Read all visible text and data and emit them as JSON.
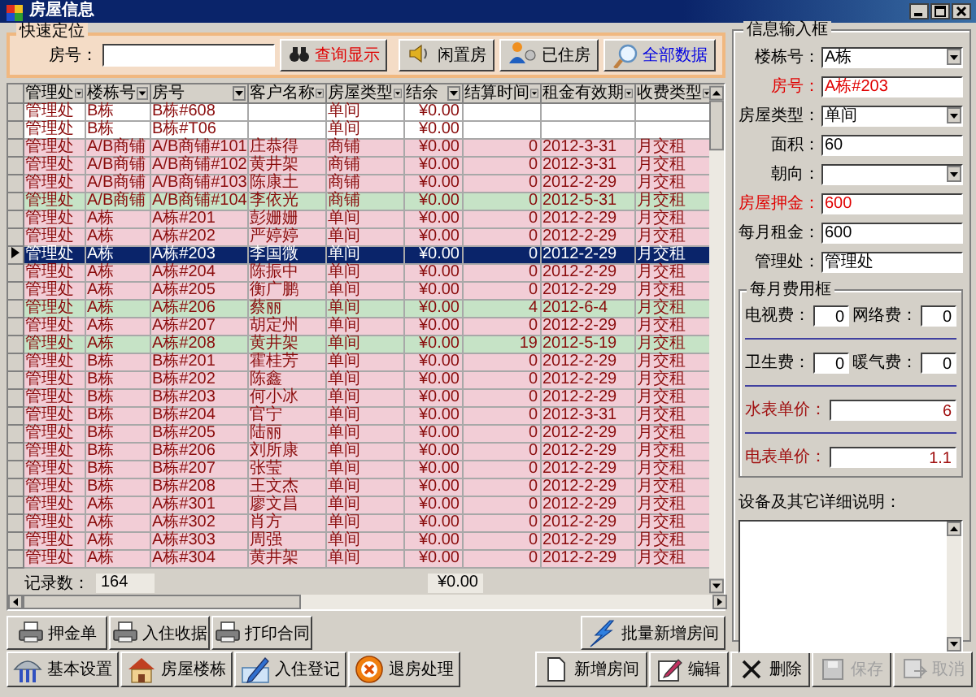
{
  "window": {
    "title": "房屋信息"
  },
  "quick_find": {
    "title": "快速定位",
    "label": "房号：",
    "search_button": "查询显示"
  },
  "filter_buttons": [
    {
      "label": "闲置房",
      "kind": "vacant"
    },
    {
      "label": "已住房",
      "kind": "occupied"
    },
    {
      "label": "全部数据",
      "kind": "all"
    }
  ],
  "table": {
    "columns": [
      "管理处",
      "楼栋号",
      "房号",
      "客户名称",
      "房屋类型",
      "结余",
      "结算时间",
      "租金有效期",
      "收费类型"
    ],
    "rows": [
      {
        "cells": [
          "管理处",
          "B栋",
          "B栋#608",
          null,
          "单间",
          "¥0.00",
          null,
          null,
          null
        ],
        "color": "#ffffff",
        "selected": false
      },
      {
        "cells": [
          "管理处",
          "B栋",
          "B栋#T06",
          null,
          "单间",
          "¥0.00",
          null,
          null,
          null
        ],
        "color": "#ffffff",
        "selected": false
      },
      {
        "cells": [
          "管理处",
          "A/B商铺",
          "A/B商铺#101",
          "庄恭得",
          "商铺",
          "¥0.00",
          "0",
          "2012-3-31",
          "月交租"
        ],
        "color": "#f2cdd6",
        "selected": false
      },
      {
        "cells": [
          "管理处",
          "A/B商铺",
          "A/B商铺#102",
          "黄井架",
          "商铺",
          "¥0.00",
          "0",
          "2012-3-31",
          "月交租"
        ],
        "color": "#f2cdd6",
        "selected": false
      },
      {
        "cells": [
          "管理处",
          "A/B商铺",
          "A/B商铺#103",
          "陈康土",
          "商铺",
          "¥0.00",
          "0",
          "2012-2-29",
          "月交租"
        ],
        "color": "#f2cdd6",
        "selected": false
      },
      {
        "cells": [
          "管理处",
          "A/B商铺",
          "A/B商铺#104",
          "李依光",
          "商铺",
          "¥0.00",
          "0",
          "2012-5-31",
          "月交租"
        ],
        "color": "#c6e3c6",
        "selected": false
      },
      {
        "cells": [
          "管理处",
          "A栋",
          "A栋#201",
          "彭姗姗",
          "单间",
          "¥0.00",
          "0",
          "2012-2-29",
          "月交租"
        ],
        "color": "#f2cdd6",
        "selected": false
      },
      {
        "cells": [
          "管理处",
          "A栋",
          "A栋#202",
          "严婷婷",
          "单间",
          "¥0.00",
          "0",
          "2012-2-29",
          "月交租"
        ],
        "color": "#f2cdd6",
        "selected": false
      },
      {
        "cells": [
          "管理处",
          "A栋",
          "A栋#203",
          "李国微",
          "单间",
          "¥0.00",
          "0",
          "2012-2-29",
          "月交租"
        ],
        "selected": true
      },
      {
        "cells": [
          "管理处",
          "A栋",
          "A栋#204",
          "陈振中",
          "单间",
          "¥0.00",
          "0",
          "2012-2-29",
          "月交租"
        ],
        "color": "#f2cdd6",
        "selected": false
      },
      {
        "cells": [
          "管理处",
          "A栋",
          "A栋#205",
          "衡广鹏",
          "单间",
          "¥0.00",
          "0",
          "2012-2-29",
          "月交租"
        ],
        "color": "#f2cdd6",
        "selected": false
      },
      {
        "cells": [
          "管理处",
          "A栋",
          "A栋#206",
          "蔡丽",
          "单间",
          "¥0.00",
          "4",
          "2012-6-4",
          "月交租"
        ],
        "color": "#c6e3c6",
        "selected": false
      },
      {
        "cells": [
          "管理处",
          "A栋",
          "A栋#207",
          "胡定州",
          "单间",
          "¥0.00",
          "0",
          "2012-2-29",
          "月交租"
        ],
        "color": "#f2cdd6",
        "selected": false
      },
      {
        "cells": [
          "管理处",
          "A栋",
          "A栋#208",
          "黄井架",
          "单间",
          "¥0.00",
          "19",
          "2012-5-19",
          "月交租"
        ],
        "color": "#c6e3c6",
        "selected": false
      },
      {
        "cells": [
          "管理处",
          "B栋",
          "B栋#201",
          "霍桂芳",
          "单间",
          "¥0.00",
          "0",
          "2012-2-29",
          "月交租"
        ],
        "color": "#f2cdd6",
        "selected": false
      },
      {
        "cells": [
          "管理处",
          "B栋",
          "B栋#202",
          "陈鑫",
          "单间",
          "¥0.00",
          "0",
          "2012-2-29",
          "月交租"
        ],
        "color": "#f2cdd6",
        "selected": false
      },
      {
        "cells": [
          "管理处",
          "B栋",
          "B栋#203",
          "何小冰",
          "单间",
          "¥0.00",
          "0",
          "2012-2-29",
          "月交租"
        ],
        "color": "#f2cdd6",
        "selected": false
      },
      {
        "cells": [
          "管理处",
          "B栋",
          "B栋#204",
          "官宁",
          "单间",
          "¥0.00",
          "0",
          "2012-3-31",
          "月交租"
        ],
        "color": "#f2cdd6",
        "selected": false
      },
      {
        "cells": [
          "管理处",
          "B栋",
          "B栋#205",
          "陆丽",
          "单间",
          "¥0.00",
          "0",
          "2012-2-29",
          "月交租"
        ],
        "color": "#f2cdd6",
        "selected": false
      },
      {
        "cells": [
          "管理处",
          "B栋",
          "B栋#206",
          "刘所康",
          "单间",
          "¥0.00",
          "0",
          "2012-2-29",
          "月交租"
        ],
        "color": "#f2cdd6",
        "selected": false
      },
      {
        "cells": [
          "管理处",
          "B栋",
          "B栋#207",
          "张莹",
          "单间",
          "¥0.00",
          "0",
          "2012-2-29",
          "月交租"
        ],
        "color": "#f2cdd6",
        "selected": false
      },
      {
        "cells": [
          "管理处",
          "B栋",
          "B栋#208",
          "王文杰",
          "单间",
          "¥0.00",
          "0",
          "2012-2-29",
          "月交租"
        ],
        "color": "#f2cdd6",
        "selected": false
      },
      {
        "cells": [
          "管理处",
          "A栋",
          "A栋#301",
          "廖文昌",
          "单间",
          "¥0.00",
          "0",
          "2012-2-29",
          "月交租"
        ],
        "color": "#f2cdd6",
        "selected": false
      },
      {
        "cells": [
          "管理处",
          "A栋",
          "A栋#302",
          "肖方",
          "单间",
          "¥0.00",
          "0",
          "2012-2-29",
          "月交租"
        ],
        "color": "#f2cdd6",
        "selected": false
      },
      {
        "cells": [
          "管理处",
          "A栋",
          "A栋#303",
          "周强",
          "单间",
          "¥0.00",
          "0",
          "2012-2-29",
          "月交租"
        ],
        "color": "#f2cdd6",
        "selected": false
      },
      {
        "cells": [
          "管理处",
          "A栋",
          "A栋#304",
          "黄井架",
          "单间",
          "¥0.00",
          "0",
          "2012-2-29",
          "月交租"
        ],
        "color": "#f2cdd6",
        "selected": false
      }
    ],
    "footer": {
      "label": "记录数：",
      "count": "164",
      "total": "¥0.00"
    }
  },
  "form": {
    "title": "信息输入框",
    "fields": [
      {
        "label": "楼栋号：",
        "value": "A栋",
        "kind": "select",
        "required": false
      },
      {
        "label": "房号：",
        "value": "A栋#203",
        "kind": "text",
        "required": true
      },
      {
        "label": "房屋类型：",
        "value": "单间",
        "kind": "select",
        "required": false
      },
      {
        "label": "面积：",
        "value": "60",
        "kind": "text",
        "required": false
      },
      {
        "label": "朝向：",
        "kind": "select",
        "required": false
      },
      {
        "label": "房屋押金：",
        "value": "600",
        "kind": "text",
        "required": true
      },
      {
        "label": "每月租金：",
        "value": "600",
        "kind": "text",
        "required": false
      },
      {
        "label": "管理处：",
        "value": "管理处",
        "kind": "text",
        "required": false
      }
    ]
  },
  "fees": {
    "title": "每月费用框",
    "rows": [
      [
        {
          "label": "电视费：",
          "value": "0",
          "emphasis": false
        },
        {
          "label": "网络费：",
          "value": "0",
          "emphasis": false
        }
      ],
      [
        {
          "label": "卫生费：",
          "value": "0",
          "emphasis": false
        },
        {
          "label": "暖气费：",
          "value": "0",
          "emphasis": false
        }
      ],
      [
        {
          "label": "水表单价：",
          "value": "6",
          "emphasis": true
        }
      ],
      [
        {
          "label": "电表单价：",
          "value": "1.1",
          "emphasis": true
        }
      ]
    ]
  },
  "notes": {
    "label": "设备及其它详细说明："
  },
  "print_buttons": [
    "押金单",
    "入住收据",
    "打印合同"
  ],
  "nav_buttons": [
    "基本设置",
    "房屋楼栋",
    "入住登记",
    "退房处理"
  ],
  "batch_button": "批量新增房间",
  "action_buttons": [
    {
      "label": "新增房间",
      "disabled": false
    },
    {
      "label": "编辑",
      "disabled": false
    },
    {
      "label": "删除",
      "disabled": false
    },
    {
      "label": "保存",
      "disabled": true
    },
    {
      "label": "取消",
      "disabled": true
    }
  ]
}
